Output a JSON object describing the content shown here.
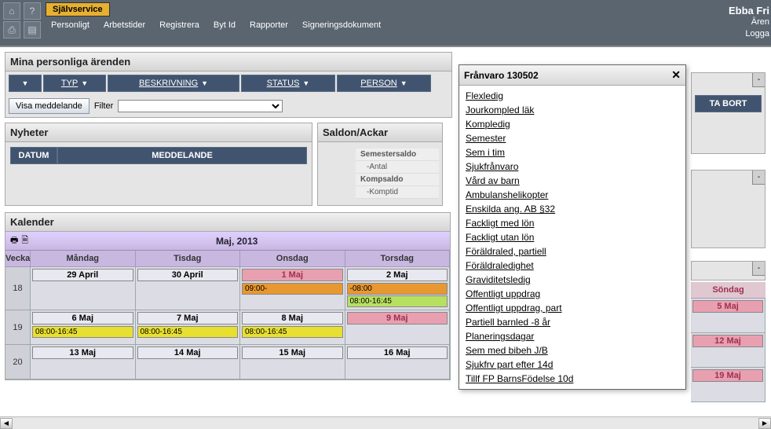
{
  "topbar": {
    "self_tab": "Självservice",
    "menu": [
      "Personligt",
      "Arbetstider",
      "Registrera",
      "Byt Id",
      "Rapporter",
      "Signeringsdokument"
    ],
    "user": "Ebba Fri",
    "lines": [
      "Ären",
      "Logga"
    ]
  },
  "errands": {
    "title": "Mina personliga ärenden",
    "cols": {
      "typ": "TYP",
      "beskrivning": "BESKRIVNING",
      "status": "STATUS",
      "person": "PERSON"
    },
    "visa": "Visa meddelande",
    "filter_label": "Filter",
    "tabort": "TA BORT"
  },
  "nyheter": {
    "title": "Nyheter",
    "cols": {
      "datum": "DATUM",
      "medd": "MEDDELANDE"
    }
  },
  "saldon": {
    "title": "Saldon/Ackar",
    "items": [
      "Semestersaldo",
      "-Antal",
      "Kompsaldo",
      "-Komptid"
    ]
  },
  "kalender": {
    "title": "Kalender",
    "month": "Maj, 2013",
    "days": [
      "Vecka",
      "Måndag",
      "Tisdag",
      "Onsdag",
      "Torsdag",
      "",
      "",
      "Söndag"
    ],
    "weeks": [
      {
        "num": "18",
        "cells": [
          {
            "date": "29 April"
          },
          {
            "date": "30 April"
          },
          {
            "date": "1 Maj",
            "holiday": true,
            "events": [
              {
                "t": "09:00-",
                "c": "ev-orange"
              }
            ]
          },
          {
            "date": "2 Maj",
            "events": [
              {
                "t": "-08:00",
                "c": "ev-orange"
              },
              {
                "t": "08:00-16:45",
                "c": "ev-green"
              }
            ]
          }
        ],
        "sun": {
          "date": "5 Maj"
        }
      },
      {
        "num": "19",
        "cells": [
          {
            "date": "6 Maj",
            "events": [
              {
                "t": "08:00-16:45",
                "c": "ev-yellow"
              }
            ]
          },
          {
            "date": "7 Maj",
            "events": [
              {
                "t": "08:00-16:45",
                "c": "ev-yellow"
              }
            ]
          },
          {
            "date": "8 Maj",
            "events": [
              {
                "t": "08:00-16:45",
                "c": "ev-yellow"
              }
            ]
          },
          {
            "date": "9 Maj",
            "holiday": true
          }
        ],
        "sun": {
          "date": "12 Maj"
        }
      },
      {
        "num": "20",
        "cells": [
          {
            "date": "13 Maj"
          },
          {
            "date": "14 Maj"
          },
          {
            "date": "15 Maj"
          },
          {
            "date": "16 Maj"
          }
        ],
        "sun": {
          "date": "19 Maj"
        }
      }
    ]
  },
  "popup": {
    "title": "Frånvaro 130502",
    "items": [
      "Flexledig",
      "Jourkompled läk",
      "Kompledig",
      "Semester",
      "Sem i tim",
      "Sjukfrånvaro",
      "Vård av barn",
      "Ambulanshelikopter",
      "Enskilda ang. AB §32",
      "Fackligt med lön",
      "Fackligt utan lön",
      "Föräldraled, partiell",
      "Föräldraledighet",
      "Graviditetsledig",
      "Offentligt uppdrag",
      "Offentligt uppdrag, part",
      "Partiell barnled -8 år",
      "Planeringsdagar",
      "Sem med bibeh J/B",
      "Sjukfrv part efter 14d",
      "Tillf FP BarnsFödelse 10d"
    ]
  }
}
